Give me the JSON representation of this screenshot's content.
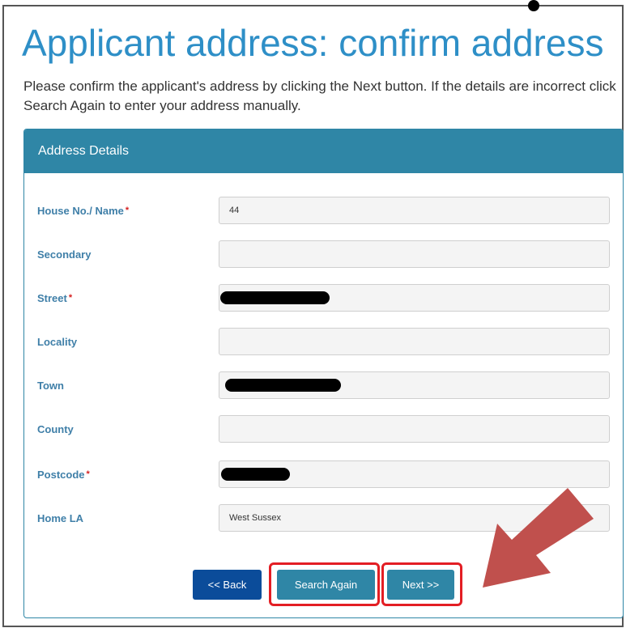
{
  "page": {
    "title": "Applicant address: confirm address",
    "intro": "Please confirm the applicant's address by clicking the Next button. If the details are incorrect click Search Again to enter your address manually."
  },
  "panel": {
    "title": "Address Details"
  },
  "fields": {
    "house": {
      "label": "House No./ Name",
      "required_mark": "*",
      "value": "44"
    },
    "secondary": {
      "label": "Secondary",
      "value": ""
    },
    "street": {
      "label": "Street",
      "required_mark": "*",
      "value": "",
      "redacted": true
    },
    "locality": {
      "label": "Locality",
      "value": ""
    },
    "town": {
      "label": "Town",
      "value": "",
      "redacted": true
    },
    "county": {
      "label": "County",
      "value": ""
    },
    "postcode": {
      "label": "Postcode",
      "required_mark": "*",
      "value": "",
      "redacted": true
    },
    "home_la": {
      "label": "Home LA",
      "value": "West Sussex"
    }
  },
  "buttons": {
    "back": "<< Back",
    "search_again": "Search Again",
    "next": "Next >>"
  },
  "colors": {
    "title": "#2e8fc7",
    "panel_header": "#2f86a6",
    "label": "#3f7fa8",
    "required": "#d51f1f",
    "back_button": "#0b4c9a",
    "primary_button": "#2f86a6",
    "annotation_highlight": "#e31e24",
    "annotation_arrow": "#c0504d"
  },
  "annotations": {
    "arrow_icon": "arrow-icon",
    "highlighted_buttons": [
      "Search Again",
      "Next >>"
    ]
  }
}
